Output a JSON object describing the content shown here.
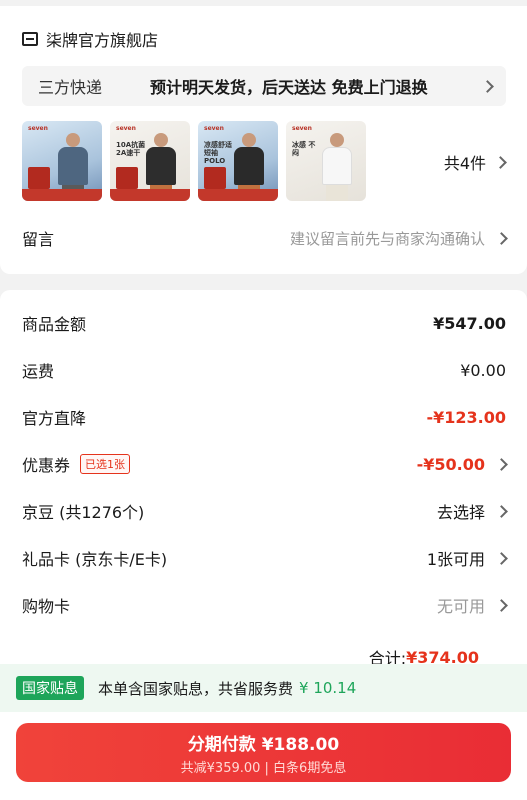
{
  "store": {
    "name": "柒牌官方旗舰店",
    "icon": "store-icon"
  },
  "shipping": {
    "method": "三方快递",
    "desc": "预计明天发货，后天送达 免费上门退换"
  },
  "items": {
    "thumbs": [
      {
        "brand": "seven",
        "tag": ""
      },
      {
        "brand": "seven",
        "tag": "10A抗菌 2A速干"
      },
      {
        "brand": "seven",
        "tag": "凉感舒适 短袖POLO"
      },
      {
        "brand": "seven",
        "tag": "冰感 不闷"
      }
    ],
    "count": "共4件"
  },
  "note": {
    "label": "留言",
    "hint": "建议留言前先与商家沟通确认"
  },
  "price_rows": [
    {
      "label": "商品金额",
      "value": "¥547.00",
      "badge": "",
      "chevron": false
    },
    {
      "label": "运费",
      "value": "¥0.00",
      "badge": "",
      "chevron": false
    },
    {
      "label": "官方直降",
      "value": "-¥123.00",
      "badge": "",
      "chevron": false
    },
    {
      "label": "优惠券",
      "value": "-¥50.00",
      "badge": "已选1张",
      "chevron": true
    },
    {
      "label": "京豆 (共1276个)",
      "value": "去选择",
      "badge": "",
      "chevron": true
    },
    {
      "label": "礼品卡 (京东卡/E卡)",
      "value": "1张可用",
      "badge": "",
      "chevron": true
    },
    {
      "label": "购物卡",
      "value": "无可用",
      "badge": "",
      "chevron": true
    }
  ],
  "total": {
    "label": "合计:",
    "value": "¥374.00"
  },
  "subsidy": {
    "badge": "国家贴息",
    "text": "本单含国家贴息，共省服务费",
    "amount": "¥ 10.14"
  },
  "pay": {
    "main": "分期付款 ¥188.00",
    "sub": "共减¥359.00 | 白条6期免息"
  },
  "colors": {
    "accent_red": "#e5331c",
    "subsidy_green": "#1ea55a"
  }
}
